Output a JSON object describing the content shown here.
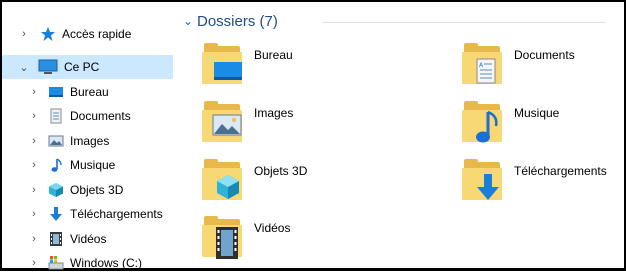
{
  "nav": {
    "items": [
      {
        "label": "Accès rapide",
        "icon": "star-icon",
        "expanded": false
      },
      {
        "label": "Ce PC",
        "icon": "computer-icon",
        "expanded": true,
        "selected": true
      },
      {
        "label": "Bureau",
        "icon": "desktop-icon"
      },
      {
        "label": "Documents",
        "icon": "documents-icon"
      },
      {
        "label": "Images",
        "icon": "images-icon"
      },
      {
        "label": "Musique",
        "icon": "music-icon"
      },
      {
        "label": "Objets 3D",
        "icon": "3d-objects-icon"
      },
      {
        "label": "Téléchargements",
        "icon": "downloads-icon"
      },
      {
        "label": "Vidéos",
        "icon": "videos-icon"
      },
      {
        "label": "Windows (C:)",
        "icon": "drive-icon"
      }
    ]
  },
  "main": {
    "group_title": "Dossiers (7)",
    "folders": [
      {
        "label": "Bureau",
        "overlay": "desktop"
      },
      {
        "label": "Documents",
        "overlay": "documents"
      },
      {
        "label": "Images",
        "overlay": "images"
      },
      {
        "label": "Musique",
        "overlay": "music"
      },
      {
        "label": "Objets 3D",
        "overlay": "3d"
      },
      {
        "label": "Téléchargements",
        "overlay": "downloads"
      },
      {
        "label": "Vidéos",
        "overlay": "videos"
      }
    ]
  },
  "colors": {
    "selection": "#cce8ff",
    "folder_front": "#f8d775",
    "folder_back": "#e8b94a",
    "accent_blue": "#1a8ce6",
    "group_title": "#1f4e8c"
  }
}
